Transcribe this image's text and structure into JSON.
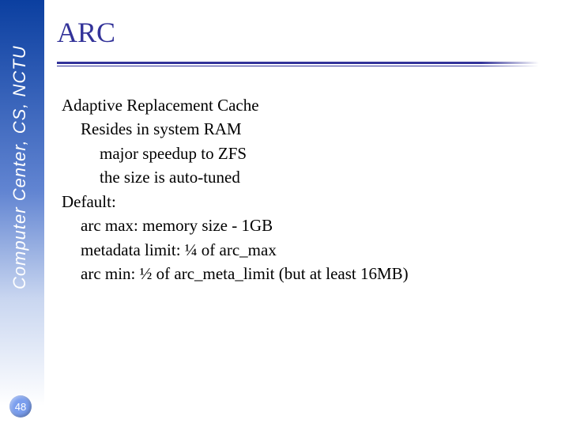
{
  "sidebar": {
    "institution": "Computer Center, CS, NCTU"
  },
  "page": {
    "number": "48"
  },
  "title": "ARC",
  "body": {
    "l1a": "Adaptive Replacement Cache",
    "l2a": "Resides in system RAM",
    "l3a": "major speedup to ZFS",
    "l3b": "the size is auto-tuned",
    "l1b": "Default:",
    "l2b": "arc max: memory size - 1GB",
    "l2c": "metadata limit: ¼ of arc_max",
    "l2d": "arc min: ½ of arc_meta_limit (but at least 16MB)"
  }
}
